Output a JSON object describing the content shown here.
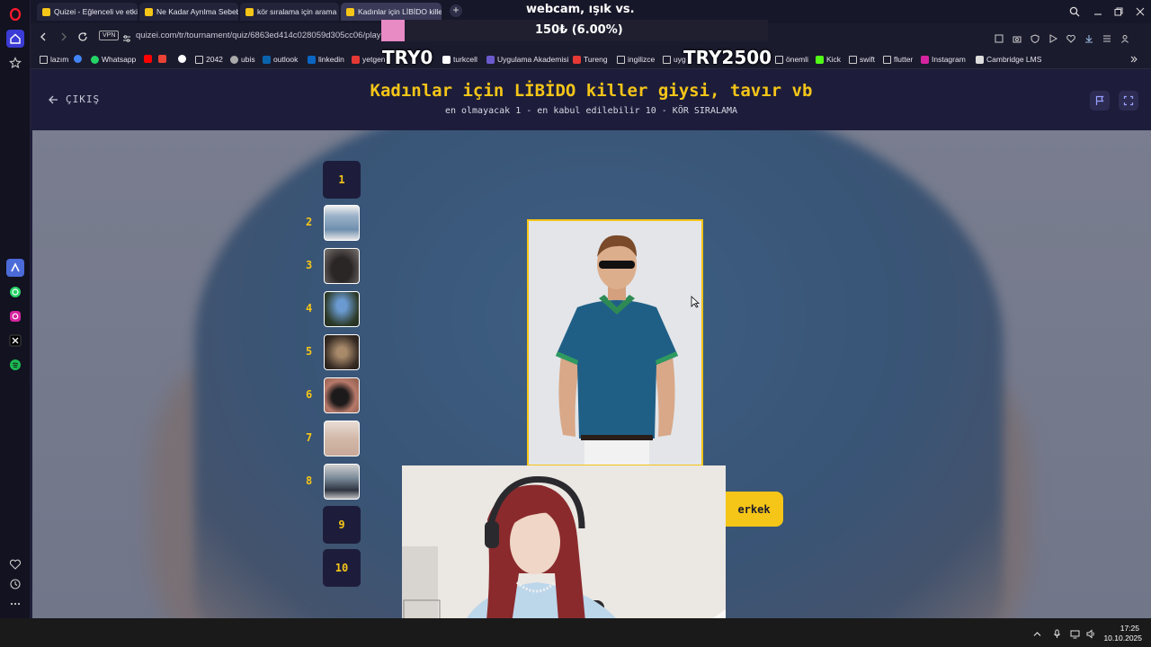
{
  "browser": {
    "tabs": [
      {
        "label": "Quizei - Eğlenceli ve etkil",
        "color": "#f5c518"
      },
      {
        "label": "Ne Kadar Ayrılma Sebebi?",
        "color": "#f5c518"
      },
      {
        "label": "kör sıralama için arama so",
        "color": "#f5c518"
      },
      {
        "label": "Kadınlar için LİBİDO killer",
        "color": "#f5c518"
      }
    ],
    "url": "quizei.com/tr/tournament/quiz/6863ed414c028059d305cc06/play",
    "vpn_label": "VPN",
    "bookmarks": [
      {
        "label": "lazım",
        "icon": "folder-icon"
      },
      {
        "label": "",
        "icon": "google-icon"
      },
      {
        "label": "Whatsapp",
        "icon": "whatsapp-icon"
      },
      {
        "label": "",
        "icon": "youtube-icon"
      },
      {
        "label": "",
        "icon": "gmail-icon"
      },
      {
        "label": "",
        "icon": "github-icon"
      },
      {
        "label": "2042",
        "icon": "folder-icon"
      },
      {
        "label": "ubis",
        "icon": "globe-icon"
      },
      {
        "label": "outlook",
        "icon": "outlook-icon"
      },
      {
        "label": "linkedin",
        "icon": "linkedin-icon"
      },
      {
        "label": "yetgen",
        "icon": "yetgen-icon"
      },
      {
        "label": "turkcell",
        "icon": "turkcell-icon"
      },
      {
        "label": "Uygulama Akademisi",
        "icon": "academy-icon"
      },
      {
        "label": "Tureng",
        "icon": "tureng-icon"
      },
      {
        "label": "ingilizce",
        "icon": "folder-icon"
      },
      {
        "label": "uyg",
        "icon": "folder-icon"
      },
      {
        "label": "önemli",
        "icon": "folder-icon"
      },
      {
        "label": "Kick",
        "icon": "kick-icon"
      },
      {
        "label": "swift",
        "icon": "folder-icon"
      },
      {
        "label": "flutter",
        "icon": "folder-icon"
      },
      {
        "label": "Instagram",
        "icon": "instagram-icon"
      },
      {
        "label": "Cambridge LMS",
        "icon": "doc-icon"
      }
    ]
  },
  "overlay": {
    "title": "webcam, ışık vs.",
    "amount": "150₺ (6.00%)",
    "min_label": "TRY0",
    "max_label": "TRY2500",
    "progress": 0.06
  },
  "quiz": {
    "exit_label": "ÇIKIŞ",
    "title": "Kadınlar için LİBİDO killer giysi, tavır vb",
    "subtitle": "en olmayacak 1 - en kabul edilebilir 10 - KÖR SIRALAMA",
    "ranks": [
      {
        "num": "1",
        "filled": false,
        "slot": "1"
      },
      {
        "num": "2",
        "filled": true,
        "slot": ""
      },
      {
        "num": "3",
        "filled": true,
        "slot": ""
      },
      {
        "num": "4",
        "filled": true,
        "slot": ""
      },
      {
        "num": "5",
        "filled": true,
        "slot": ""
      },
      {
        "num": "6",
        "filled": true,
        "slot": ""
      },
      {
        "num": "7",
        "filled": true,
        "slot": ""
      },
      {
        "num": "8",
        "filled": true,
        "slot": ""
      },
      {
        "num": "9",
        "filled": false,
        "slot": "9"
      },
      {
        "num": "10",
        "filled": false,
        "slot": "10"
      }
    ],
    "choice_label": "erkek"
  },
  "taskbar": {
    "time": "17:25",
    "date": "10.10.2025"
  },
  "colors": {
    "accent": "#f5c518",
    "page_bg": "#1d1d3b",
    "overlay_fill": "#e88ac4"
  }
}
